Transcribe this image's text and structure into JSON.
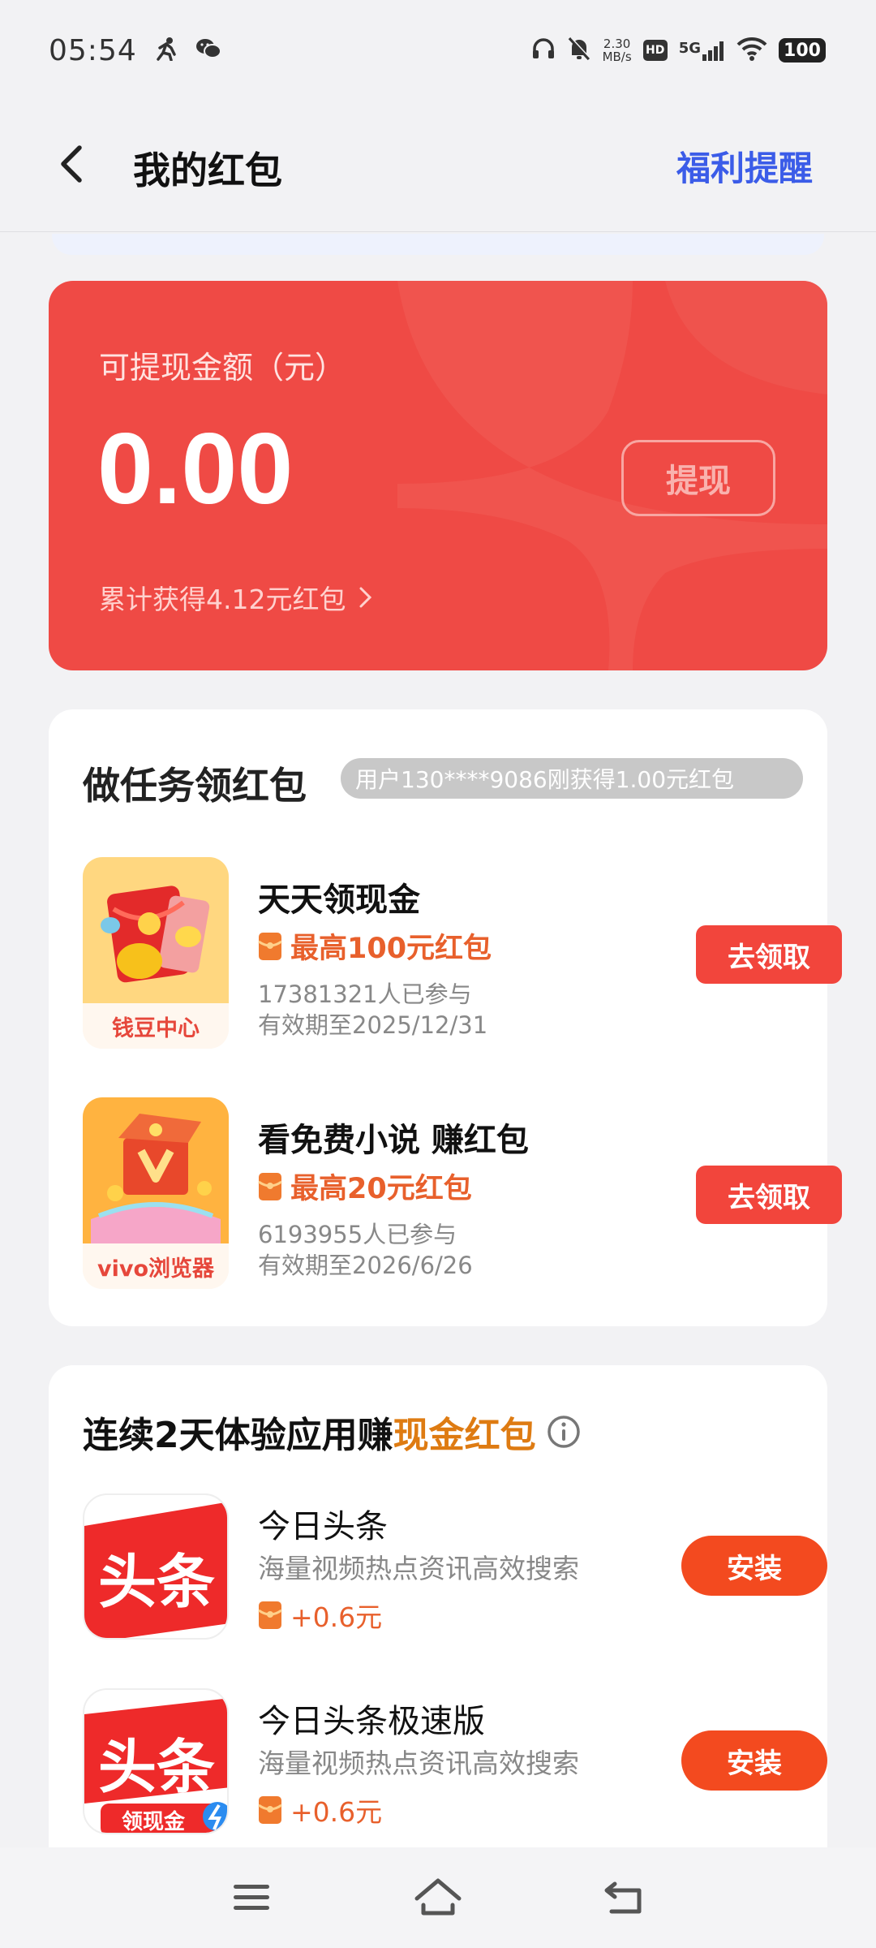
{
  "status": {
    "time": "05:54",
    "net_speed_value": "2.30",
    "net_speed_unit": "MB/s",
    "hd": "HD",
    "network": "5G",
    "battery": "100"
  },
  "header": {
    "title": "我的红包",
    "action": "福利提醒"
  },
  "balance": {
    "label": "可提现金额（元）",
    "amount": "0.00",
    "withdraw_label": "提现",
    "total_earned": "累计获得4.12元红包"
  },
  "tasks": {
    "title": "做任务领红包",
    "ticker": "用户130****9086刚获得1.00元红包",
    "items": [
      {
        "icon_label": "钱豆中心",
        "name": "天天领现金",
        "reward": "最高100元红包",
        "participants": "17381321人已参与",
        "validity": "有效期至2025/12/31",
        "button": "去领取"
      },
      {
        "icon_label": "vivo浏览器",
        "name": "看免费小说 赚红包",
        "reward": "最高20元红包",
        "participants": "6193955人已参与",
        "validity": "有效期至2026/6/26",
        "button": "去领取"
      }
    ]
  },
  "apps": {
    "title_prefix": "连续2天体验应用赚",
    "title_highlight": "现金红包",
    "items": [
      {
        "icon_text": "头条",
        "icon_sub": "",
        "name": "今日头条",
        "desc": "海量视频热点资讯高效搜索",
        "reward": "+0.6元",
        "button": "安装"
      },
      {
        "icon_text": "头条",
        "icon_sub": "领现金",
        "name": "今日头条极速版",
        "desc": "海量视频热点资讯高效搜索",
        "reward": "+0.6元",
        "button": "安装"
      }
    ]
  },
  "colors": {
    "accent_blue": "#3b5ce8",
    "card_red": "#ef4a45",
    "claim_red": "#f2453c",
    "install_orange": "#f34a1f",
    "reward_orange": "#e8602c",
    "highlight_gold": "#de7b12"
  },
  "icons": [
    "back-arrow-icon",
    "chevron-right-icon",
    "red-packet-icon",
    "info-icon",
    "menu-icon",
    "home-icon",
    "back-icon"
  ]
}
